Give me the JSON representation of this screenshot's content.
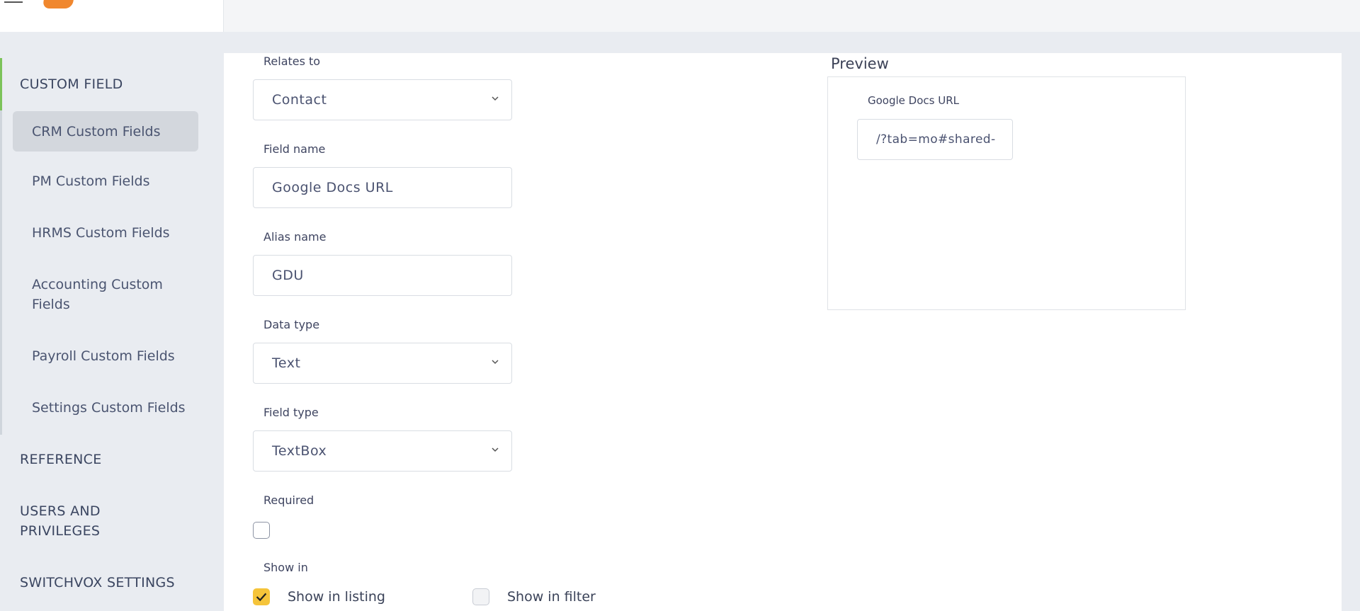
{
  "sidebar": {
    "sections": [
      {
        "label": "CUSTOM FIELD"
      },
      {
        "label": "REFERENCE"
      },
      {
        "label": "USERS AND PRIVILEGES"
      },
      {
        "label": "SWITCHVOX SETTINGS"
      }
    ],
    "items": [
      {
        "label": "CRM Custom Fields"
      },
      {
        "label": "PM Custom Fields"
      },
      {
        "label": "HRMS Custom Fields"
      },
      {
        "label": "Accounting Custom Fields"
      },
      {
        "label": "Payroll Custom Fields"
      },
      {
        "label": "Settings Custom Fields"
      }
    ]
  },
  "form": {
    "relates_to": {
      "label": "Relates to",
      "value": "Contact"
    },
    "field_name": {
      "label": "Field name",
      "value": "Google Docs URL"
    },
    "alias_name": {
      "label": "Alias name",
      "value": "GDU"
    },
    "data_type": {
      "label": "Data type",
      "value": "Text"
    },
    "field_type": {
      "label": "Field type",
      "value": "TextBox"
    },
    "required": {
      "label": "Required",
      "checked": false
    },
    "show_in": {
      "label": "Show in",
      "listing": {
        "label": "Show in listing",
        "checked": true
      },
      "filter": {
        "label": "Show in filter",
        "checked": false
      }
    }
  },
  "preview": {
    "title": "Preview",
    "field_label": "Google Docs URL",
    "field_value": "/?tab=mo#shared-"
  },
  "colors": {
    "accent_green": "#7cc35a",
    "checkbox_yellow": "#f5c43a",
    "logo_orange": "#f0872e"
  }
}
